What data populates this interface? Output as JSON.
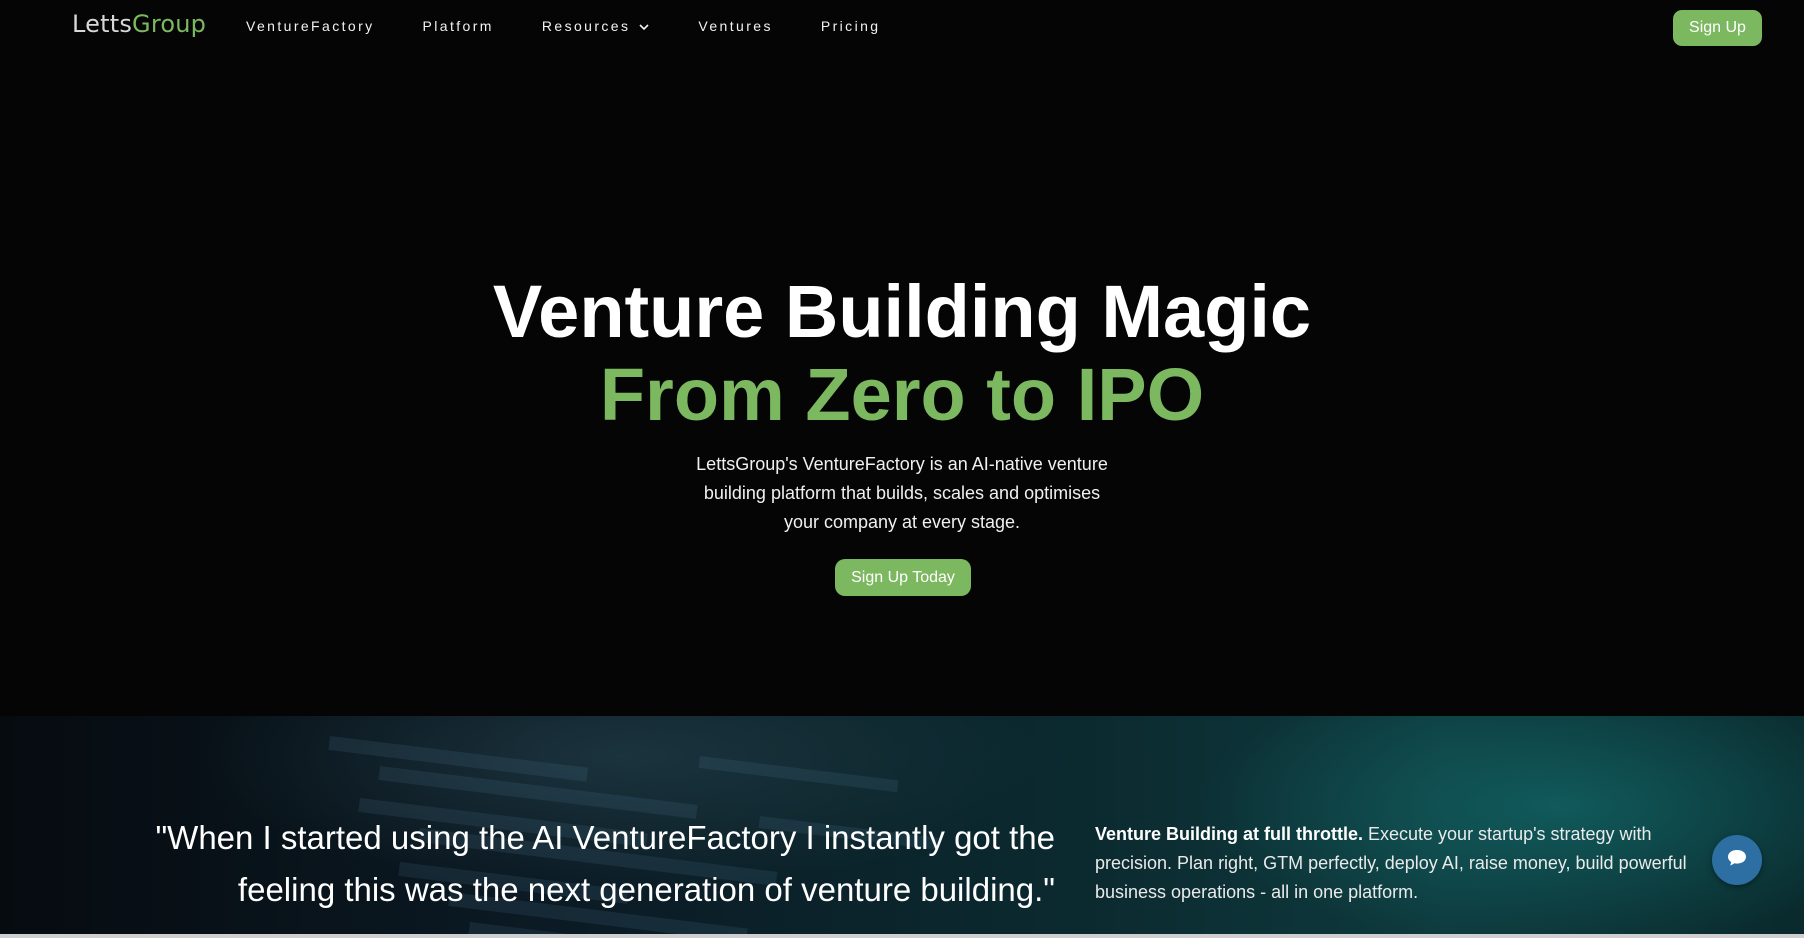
{
  "nav": {
    "logo_part1": "Letts",
    "logo_part2": "Group",
    "items": [
      {
        "label": "VentureFactory"
      },
      {
        "label": "Platform"
      },
      {
        "label": "Resources"
      },
      {
        "label": "Ventures"
      },
      {
        "label": "Pricing"
      }
    ],
    "signup_label": "Sign Up"
  },
  "hero": {
    "title_line1": "Venture Building Magic",
    "title_line2": "From Zero to IPO",
    "subtitle": "LettsGroup's VentureFactory is an AI-native venture building platform that builds, scales and optimises your company at every stage.",
    "cta_label": "Sign Up Today"
  },
  "band": {
    "quote": "\"When I started using the AI VentureFactory I instantly got the feeling this was the next generation of venture building.\"",
    "feature_bold": "Venture Building at full throttle.",
    "feature_text": " Execute your startup's strategy with precision. Plan right, GTM perfectly, deploy AI, raise money, build powerful business operations - all in one platform."
  },
  "colors": {
    "accent": "#7cb860",
    "background": "#050505",
    "chat": "#2d6fa3"
  },
  "icons": {
    "resources_dropdown": "chevron-down-icon",
    "chat": "chat-bubble-icon"
  }
}
